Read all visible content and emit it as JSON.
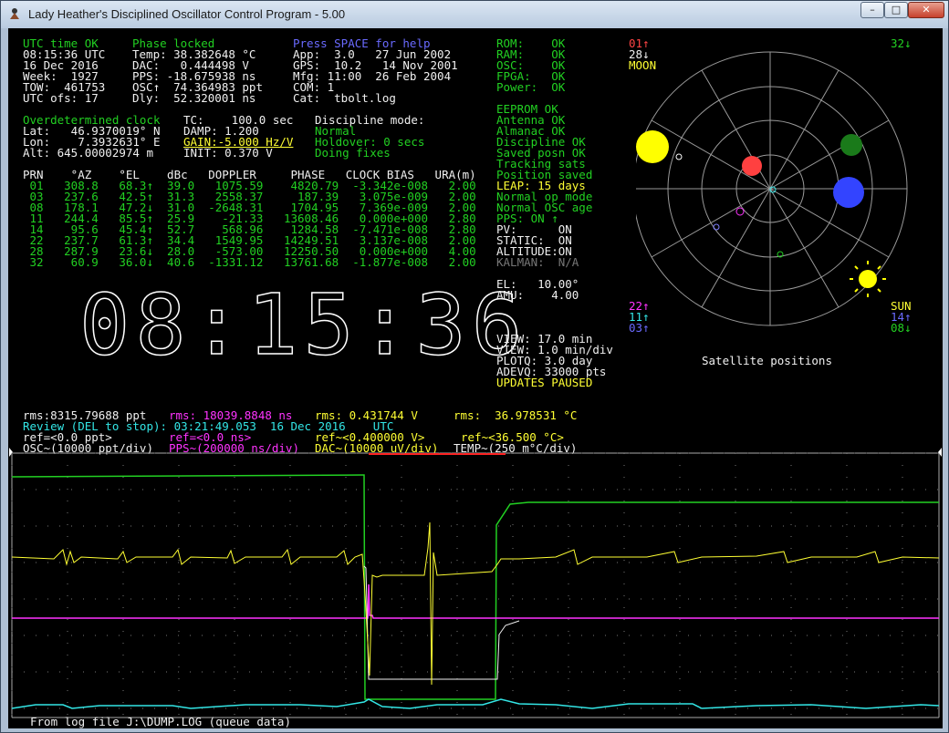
{
  "window": {
    "title": "Lady Heather's Disciplined Oscillator Control Program - 5.00",
    "min": "–",
    "max": "□",
    "close": "✕"
  },
  "status": {
    "col1": [
      "UTC time OK",
      "08:15:36 UTC",
      "16 Dec 2016",
      "Week:  1927",
      "TOW:  461753",
      "UTC ofs: 17"
    ],
    "col2": [
      "Phase locked",
      "Temp: 38.382648 °C",
      "DAC:   0.444498 V",
      "PPS: -18.675938 ns",
      "OSC↑  74.364983 ppt",
      "Dly:  52.320001 ns"
    ],
    "col3_help": "Press SPACE for help",
    "col3": [
      "App:  3.0   27 Jun 2002",
      "GPS:  10.2   14 Nov 2001",
      "Mfg: 11:00  26 Feb 2004",
      "COM: 1",
      "Cat:  tbolt.log"
    ]
  },
  "position": {
    "header": "Overdetermined clock",
    "lines": [
      "Lat:   46.9370019° N",
      "Lon:    7.3932631° E",
      "Alt: 645.00002974 m"
    ],
    "tc": "TC:    100.0 sec",
    "damp": "DAMP: 1.200",
    "gain": "GAIN:-5.000 Hz/V",
    "init": "INIT: 0.370 V",
    "disc_label": "Discipline mode:",
    "disc_mode": "Normal",
    "holdover": "Holdover: 0 secs",
    "doing": "Doing fixes"
  },
  "sat_table": {
    "header": "PRN    °AZ    °EL    dBc   DOPPLER     PHASE   CLOCK BIAS   URA(m)",
    "rows": [
      " 01   308.8   68.3↑  39.0   1075.59    4820.79  -3.342e-008   2.00",
      " 03   237.6   42.5↑  31.3   2558.37     187.39   3.075e-009   2.00",
      " 08   178.1   47.2↓  31.0  -2648.31    1704.95   7.369e-009   2.00",
      " 11   244.4   85.5↑  25.9    -21.33   13608.46   0.000e+000   2.80",
      " 14    95.6   45.4↑  52.7    568.96    1284.58  -7.471e-008   2.80",
      " 22   237.7   61.3↑  34.4   1549.95   14249.51   3.137e-008   2.00",
      " 28   287.9   23.6↓  28.0   -573.00   12250.50   0.000e+000   4.00",
      " 32    60.9   36.0↓  40.6  -1331.12   13761.68  -1.877e-008   2.00"
    ]
  },
  "big_clock": "08:15:36",
  "health": {
    "a": [
      "ROM:    OK",
      "RAM:    OK",
      "OSC:    OK",
      "FPGA:   OK",
      "Power:  OK"
    ],
    "b": [
      "EEPROM OK",
      "Antenna OK",
      "Almanac OK",
      "Discipline OK",
      "Saved posn OK",
      "Tracking sats",
      "Position saved"
    ],
    "leap": "LEAP: 15 days",
    "c": [
      "Normal op mode",
      "Normal OSC age",
      "PPS: ON ↑"
    ],
    "d": [
      "PV:      ON",
      "STATIC:  ON",
      "ALTITUDE:ON"
    ],
    "kalman": "KALMAN:  N/A",
    "el": "EL:   10.00°",
    "amu": "AMU:    4.00",
    "view": [
      "VIEW: 17.0 min",
      "VIEW: 1.0 min/div",
      "PLOTQ: 3.0 day",
      "ADEVQ: 33000 pts"
    ],
    "paused": "UPDATES PAUSED"
  },
  "sky": {
    "title": "Satellite positions",
    "tl": [
      "01↑",
      "28↓"
    ],
    "moon": "MOON",
    "tr": "32↓",
    "bl": [
      "22↑",
      "11↑",
      "03↑"
    ],
    "sun": "SUN",
    "br": [
      "14↑",
      "08↓"
    ]
  },
  "plot_header": {
    "rms_osc": "rms:8315.79688 ppt",
    "rms_pps": "rms: 18039.8848 ns",
    "rms_dac": "rms: 0.431744 V",
    "rms_temp": "rms:  36.978531 °C",
    "review": "Review (DEL to stop): 03:21:49.053  16 Dec 2016    UTC",
    "ref_osc": "ref=<0.0 ppt>",
    "ref_pps": "ref=<0.0 ns>",
    "ref_dac": "ref~<0.400000 V>",
    "ref_temp": "ref~<36.500 °C>",
    "osc": "OSC~(10000 ppt/div)",
    "pps": "PPS~(200000 ns/div)",
    "dac": "DAC~(10000 uV/div)",
    "temp": "TEMP~(250 m°C/div)"
  },
  "footer": "From log file J:\\DUMP.LOG (queue data)",
  "colors": {
    "osc": "#22d022",
    "pps": "#ff33ff",
    "dac": "#ffff33",
    "temp": "#f0f0f0",
    "adev": "#33e6e6",
    "grid": "#777777"
  }
}
